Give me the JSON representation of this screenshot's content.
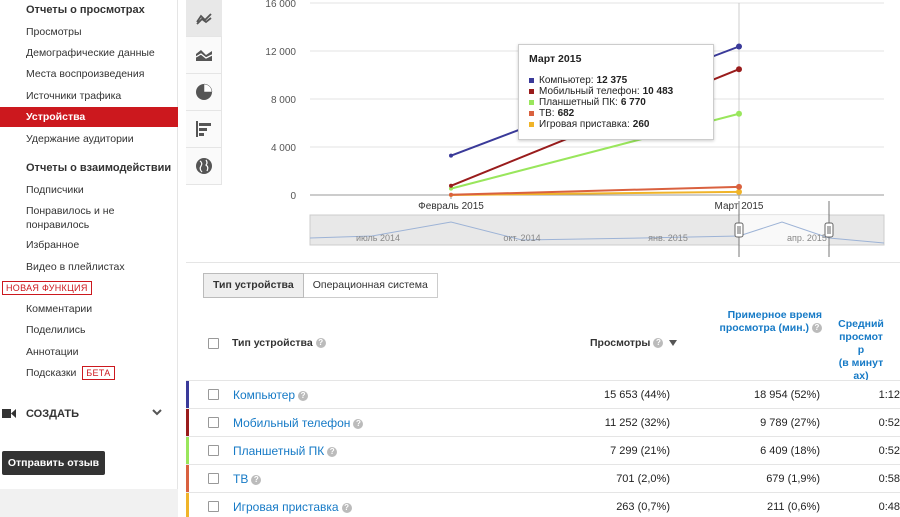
{
  "sidebar": {
    "section1": "Отчеты о просмотрах",
    "items1": [
      "Просмотры",
      "Демографические данные",
      "Места воспроизведения",
      "Источники трафика",
      "Устройства",
      "Удержание аудитории"
    ],
    "section2": "Отчеты о взаимодействии",
    "items2": [
      "Подписчики",
      "Понравилось и не",
      "понравилось",
      "Избранное",
      "Видео в плейлистах"
    ],
    "new_badge": "НОВАЯ ФУНКЦИЯ",
    "items3": [
      "Комментарии",
      "Поделились",
      "Аннотации",
      "Подсказки"
    ],
    "beta_badge": "БЕТА",
    "create": "СОЗДАТЬ",
    "feedback": "Отправить отзыв"
  },
  "tools": [
    "line-chart-icon",
    "area-chart-icon",
    "pie-chart-icon",
    "bar-chart-icon",
    "globe-icon"
  ],
  "chart_data": {
    "type": "line",
    "x": [
      "Февраль 2015",
      "Март 2015"
    ],
    "yticks": [
      "0",
      "4 000",
      "8 000",
      "12 000",
      "16 000"
    ],
    "ylim": [
      0,
      16000
    ],
    "series": [
      {
        "name": "Компьютер",
        "color": "#3a3a99",
        "values": [
          3278,
          12375
        ]
      },
      {
        "name": "Мобильный телефон",
        "color": "#991c1c",
        "values": [
          769,
          10483
        ]
      },
      {
        "name": "Планшетный ПК",
        "color": "#99e65c",
        "values": [
          529,
          6770
        ]
      },
      {
        "name": "ТВ",
        "color": "#d9613f",
        "values": [
          19,
          682
        ]
      },
      {
        "name": "Игровая приставка",
        "color": "#f0b429",
        "values": [
          3,
          260
        ]
      }
    ],
    "timeline_labels": [
      "июль 2014",
      "окт. 2014",
      "янв. 2015",
      "апр. 2015"
    ]
  },
  "tooltip": {
    "title": "Март 2015",
    "rows": [
      {
        "label": "Компьютер:",
        "value": "12 375"
      },
      {
        "label": "Мобильный телефон:",
        "value": "10 483"
      },
      {
        "label": "Планшетный ПК:",
        "value": "6 770"
      },
      {
        "label": "ТВ:",
        "value": "682"
      },
      {
        "label": "Игровая приставка:",
        "value": "260"
      }
    ]
  },
  "tabs": [
    "Тип устройства",
    "Операционная система"
  ],
  "table": {
    "col_type": "Тип устройства",
    "col_views": "Просмотры",
    "col_watch_1": "Примерное время",
    "col_watch_2": "просмотра (мин.)",
    "col_avg_1": "Средний",
    "col_avg_2": "просмот",
    "col_avg_3": "р",
    "col_avg_4": "(в минут",
    "col_avg_5": "ах)",
    "rows": [
      {
        "name": "Компьютер",
        "views": "15 653 (44%)",
        "watch": "18 954 (52%)",
        "avg": "1:12",
        "color": "#3a3a99"
      },
      {
        "name": "Мобильный телефон",
        "views": "11 252 (32%)",
        "watch": "9 789 (27%)",
        "avg": "0:52",
        "color": "#991c1c"
      },
      {
        "name": "Планшетный ПК",
        "views": "7 299 (21%)",
        "watch": "6 409 (18%)",
        "avg": "0:52",
        "color": "#99e65c"
      },
      {
        "name": "ТВ",
        "views": "701 (2,0%)",
        "watch": "679 (1,9%)",
        "avg": "0:58",
        "color": "#d9613f"
      },
      {
        "name": "Игровая приставка",
        "views": "263 (0,7%)",
        "watch": "211 (0,6%)",
        "avg": "0:48",
        "color": "#f0b429"
      }
    ]
  }
}
